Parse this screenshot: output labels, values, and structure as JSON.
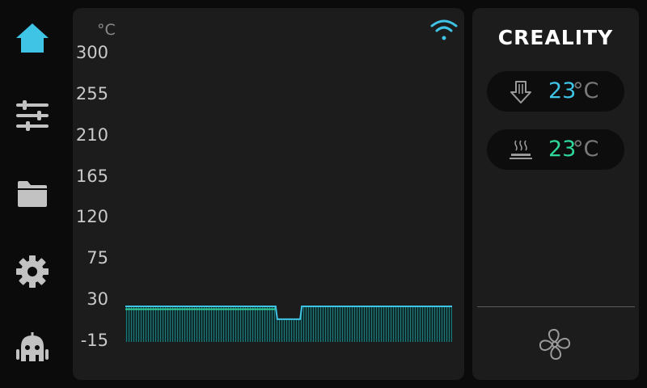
{
  "sidebar": {
    "items": [
      {
        "icon": "home-icon",
        "active": true
      },
      {
        "icon": "sliders-icon"
      },
      {
        "icon": "folder-icon"
      },
      {
        "icon": "gear-icon"
      },
      {
        "icon": "robot-icon"
      }
    ],
    "active_color": "#3fc4e6",
    "inactive_color": "#c2c2c2"
  },
  "chart": {
    "unit": "°C",
    "status_icon": "wifi-icon"
  },
  "chart_data": {
    "type": "area",
    "y_ticks": [
      "300",
      "255",
      "210",
      "165",
      "120",
      "75",
      "30",
      "-15"
    ],
    "ylim": [
      -15,
      300
    ],
    "series": [
      {
        "color": "#3fc4e6",
        "x": [
          0,
          46,
          46.5,
          53.5,
          54,
          100
        ],
        "values": [
          23,
          23,
          9,
          9,
          23,
          23
        ]
      },
      {
        "color": "#2fcf9a",
        "x": [
          0,
          46
        ],
        "values": [
          20,
          20
        ]
      }
    ],
    "grid": false
  },
  "info": {
    "logo": "CREALITY",
    "nozzle": {
      "icon": "nozzle-icon",
      "value": "23",
      "unit": "°C",
      "color": "#3fc4e6"
    },
    "bed": {
      "icon": "heated-bed-icon",
      "value": "23",
      "unit": "°C",
      "color": "#2fd69a"
    },
    "fan_icon": "fan-icon"
  }
}
